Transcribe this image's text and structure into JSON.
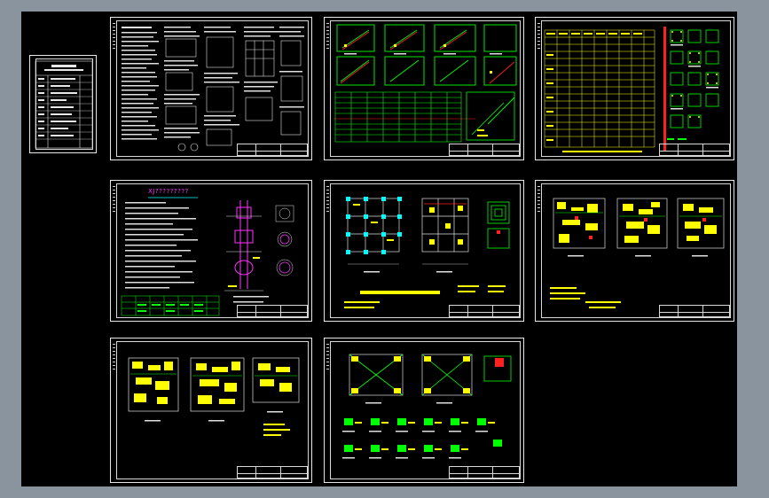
{
  "window": {
    "background": "#8a949e",
    "canvas": "#000000"
  },
  "sheets": [
    {
      "id": "index",
      "kind": "drawing-index"
    },
    {
      "id": "general-notes",
      "kind": "text-notes"
    },
    {
      "id": "stair-details",
      "kind": "stair-details"
    },
    {
      "id": "column-schedule",
      "kind": "column-schedule"
    },
    {
      "id": "foundation-notes",
      "kind": "foundation-notes",
      "title": "XJ?????????"
    },
    {
      "id": "foundation-plan",
      "kind": "plan"
    },
    {
      "id": "floor-reinforcement-1",
      "kind": "plan"
    },
    {
      "id": "floor-reinforcement-2",
      "kind": "plan"
    },
    {
      "id": "roof-plan",
      "kind": "plan"
    }
  ],
  "colors": {
    "white": "#e8e8e8",
    "yellow": "#ffff00",
    "green": "#00ff00",
    "cyan": "#00ffff",
    "red": "#ff2020",
    "magenta": "#ff33ff"
  }
}
